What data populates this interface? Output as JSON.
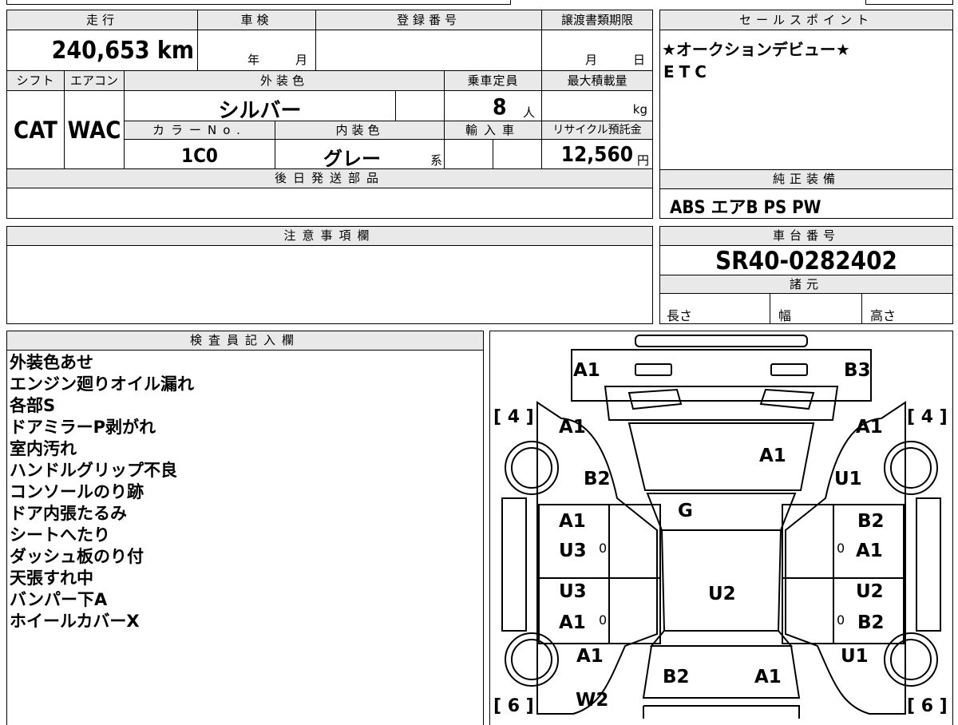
{
  "header": {
    "mileage_label": "走行",
    "inspection_label": "車検",
    "registration_label": "登録番号",
    "transfer_deadline_label": "譲渡書類期限",
    "sales_point_label": "セールスポイント"
  },
  "vehicle": {
    "mileage": "240,653 km",
    "inspection_year_unit": "年",
    "inspection_month_unit": "月",
    "transfer_month_unit": "月",
    "transfer_day_unit": "日",
    "shift_label": "シフト",
    "aircon_label": "エアコン",
    "exterior_color_label": "外装色",
    "capacity_label": "乗車定員",
    "max_load_label": "最大積載量",
    "shift": "CAT",
    "aircon": "WAC",
    "exterior_color": "シルバー",
    "capacity": "8",
    "capacity_unit": "人",
    "max_load_unit": "kg",
    "color_no_label": "カラーNo.",
    "interior_color_label": "内装色",
    "import_label": "輸入車",
    "recycle_label": "リサイクル預託金",
    "color_no": "1C0",
    "interior_color": "グレー",
    "interior_color_suffix": "系",
    "recycle_fee": "12,560",
    "recycle_unit": "円",
    "later_parts_label": "後日発送部品"
  },
  "sales_points": [
    "★オークションデビュー★",
    "ETC"
  ],
  "equipment": {
    "label": "純正装備",
    "items": "ABS エアB PS PW"
  },
  "caution": {
    "label": "注意事項欄"
  },
  "chassis": {
    "label": "車台番号",
    "number": "SR40-0282402",
    "specs_label": "諸元",
    "length_label": "長さ",
    "width_label": "幅",
    "height_label": "高さ"
  },
  "inspector": {
    "label": "検査員記入欄",
    "notes": [
      "外装色あせ",
      "エンジン廻りオイル漏れ",
      "各部S",
      "ドアミラーP剥がれ",
      "室内汚れ",
      "ハンドルグリップ不良",
      "コンソールのり跡",
      "ドア内張たるみ",
      "シートへたり",
      "ダッシュ板のり付",
      "天張すれ中",
      "バンパー下A",
      "ホイールカバーX"
    ]
  },
  "diagram": {
    "tire_front_left": "[ 4 ]",
    "tire_front_right": "[ 4 ]",
    "tire_rear_left": "[ 6 ]",
    "tire_rear_right": "[ 6 ]",
    "marks": {
      "front_bumper_left": "A1",
      "front_bumper_right": "B3",
      "fender_front_left": "A1",
      "fender_front_right": "A1",
      "hood": "A1",
      "fender_lower_left": "B2",
      "fender_lower_right": "U1",
      "windshield": "G",
      "front_door_left_top": "A1",
      "front_door_left_bottom": "U3",
      "front_door_right_top": "B2",
      "front_door_right_bottom": "A1",
      "roof": "U2",
      "rear_door_left_top": "U3",
      "rear_door_left_bottom": "A1",
      "rear_door_right_top": "U2",
      "rear_door_right_bottom": "B2",
      "quarter_left": "A1",
      "quarter_right": "U1",
      "rear_left": "B2",
      "rear_right": "A1",
      "rear_bumper": "W2"
    },
    "small_marks": {
      "front_door_left": "0",
      "front_door_right": "0",
      "rear_door_left": "0",
      "rear_door_right": "0"
    }
  }
}
